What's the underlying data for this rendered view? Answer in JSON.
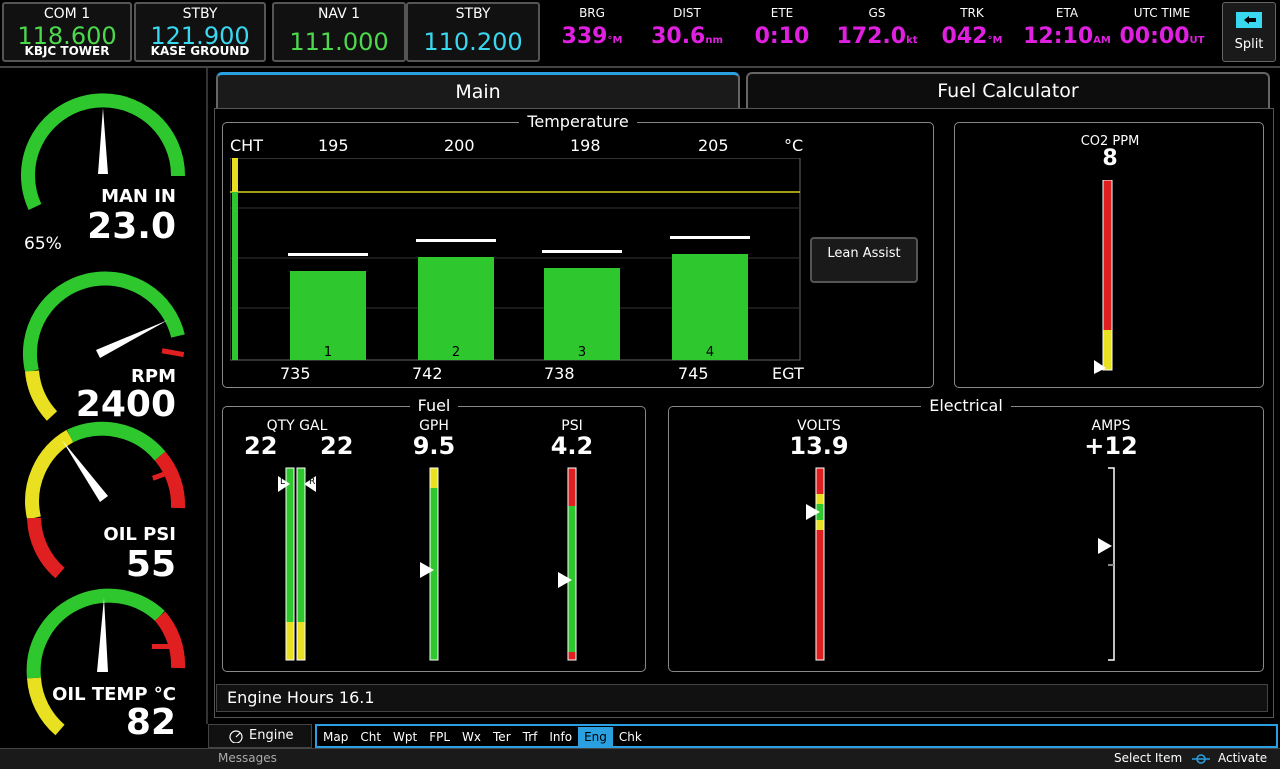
{
  "radios": {
    "com1": {
      "title": "COM 1",
      "freq": "118.600",
      "sub": "KBJC TOWER"
    },
    "com_stby": {
      "title": "STBY",
      "freq": "121.900",
      "sub": "KASE GROUND"
    },
    "nav1": {
      "title": "NAV 1",
      "freq": "111.000"
    },
    "nav_stby": {
      "title": "STBY",
      "freq": "110.200"
    }
  },
  "datafields": [
    {
      "label": "BRG",
      "value": "339",
      "unit": "°M"
    },
    {
      "label": "DIST",
      "value": "30.6",
      "unit": "nm"
    },
    {
      "label": "ETE",
      "value": "0:10",
      "unit": ""
    },
    {
      "label": "GS",
      "value": "172.0",
      "unit": "kt"
    },
    {
      "label": "TRK",
      "value": "042",
      "unit": "°M"
    },
    {
      "label": "ETA",
      "value": "12:10",
      "unit": "AM"
    },
    {
      "label": "UTC TIME",
      "value": "00:00",
      "unit": "UT"
    }
  ],
  "split_label": "Split",
  "gauges": {
    "man": {
      "label": "MAN IN",
      "value": "23.0",
      "pct": "65%"
    },
    "rpm": {
      "label": "RPM",
      "value": "2400"
    },
    "oilpsi": {
      "label": "OIL PSI",
      "value": "55"
    },
    "oiltemp": {
      "label": "OIL TEMP °C",
      "value": "82"
    }
  },
  "tabs": {
    "main": "Main",
    "fuel_calc": "Fuel Calculator"
  },
  "temperature": {
    "title": "Temperature",
    "cht_label": "CHT",
    "cht_values": [
      "195",
      "200",
      "198",
      "205"
    ],
    "unit": "°C",
    "egt_label": "EGT",
    "egt_values": [
      "735",
      "742",
      "738",
      "745"
    ],
    "cyl_labels": [
      "1",
      "2",
      "3",
      "4"
    ],
    "lean_assist": "Lean Assist"
  },
  "co2": {
    "label": "CO2 PPM",
    "value": "8"
  },
  "fuel": {
    "title": "Fuel",
    "qty_label": "QTY GAL",
    "qty_left": "22",
    "qty_right": "22",
    "qty_l_marker": "L",
    "qty_r_marker": "R",
    "gph_label": "GPH",
    "gph_value": "9.5",
    "psi_label": "PSI",
    "psi_value": "4.2"
  },
  "electrical": {
    "title": "Electrical",
    "volts_label": "VOLTS",
    "volts_value": "13.9",
    "amps_label": "AMPS",
    "amps_value": "+12"
  },
  "engine_hours": "Engine Hours 16.1",
  "engine_button": "Engine",
  "nav_items": [
    "Map",
    "Cht",
    "Wpt",
    "FPL",
    "Wx",
    "Ter",
    "Trf",
    "Info",
    "Eng",
    "Chk"
  ],
  "nav_active": "Eng",
  "status": {
    "messages": "Messages",
    "select_item": "Select Item",
    "activate": "Activate"
  },
  "colors": {
    "green": "#4cd94c",
    "cyan": "#3ad7f0",
    "magenta": "#e020e0",
    "yellow": "#e8e020",
    "red": "#e02020",
    "accent": "#2aa0e0"
  }
}
